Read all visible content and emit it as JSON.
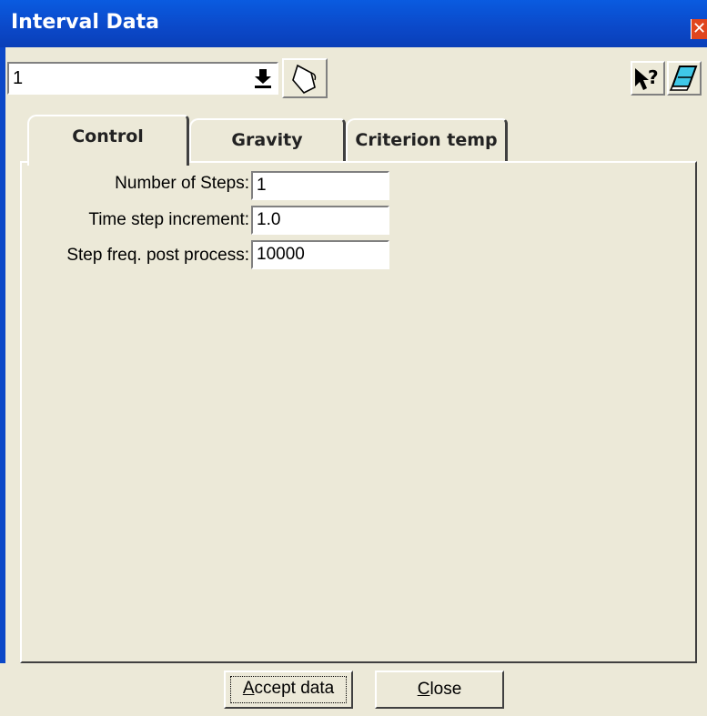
{
  "window": {
    "title": "Interval Data"
  },
  "toolbar": {
    "selected_value": "1",
    "help_label": "?"
  },
  "tabs": [
    {
      "label": "Control"
    },
    {
      "label": "Gravity"
    },
    {
      "label": "Criterion temp"
    }
  ],
  "fields": [
    {
      "label": "Number of Steps:",
      "value": "1"
    },
    {
      "label": "Time step increment:",
      "value": "1.0"
    },
    {
      "label": "Step freq. post process:",
      "value": "10000"
    }
  ],
  "buttons": {
    "accept": {
      "mnemonic": "A",
      "rest": "ccept data"
    },
    "close": {
      "mnemonic": "C",
      "rest": "lose"
    }
  },
  "colors": {
    "titlebar": "#0b48c8",
    "window_bg": "#ece9d8",
    "close_button": "#e0451e"
  }
}
